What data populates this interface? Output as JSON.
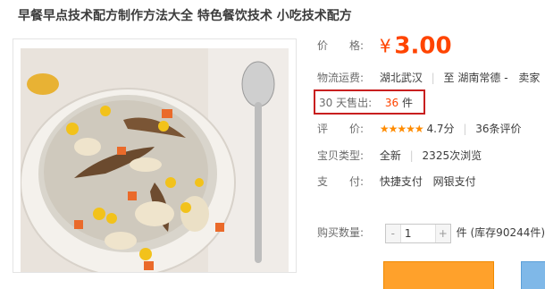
{
  "title": "早餐早点技术配方制作方法大全 特色餐饮技术 小吃技术配方",
  "price": {
    "label": "价　　格:",
    "symbol": "¥",
    "value": "3.00"
  },
  "shipping": {
    "label": "物流运费:",
    "from": "湖北武汉",
    "divider": "至",
    "to": "湖南常德",
    "chevron": "-",
    "seller": "卖家"
  },
  "sales": {
    "label": "30 天售出:",
    "count": "36",
    "unit": "件"
  },
  "rating": {
    "label": "评　　价:",
    "stars": "★★★★★",
    "score": "4.7分",
    "reviews": "36条评价"
  },
  "item_info": {
    "label": "宝贝类型:",
    "condition": "全新",
    "views": "2325次浏览"
  },
  "payment": {
    "label": "支　　付:",
    "methods": [
      "快捷支付",
      "网银支付"
    ]
  },
  "quantity": {
    "label": "购买数量:",
    "minus": "-",
    "value": "1",
    "plus": "+",
    "unit": "件",
    "stock": "(库存90244件)"
  },
  "colors": {
    "price": "#ff4400",
    "sold_box_border": "#c81f1f",
    "buy_button": "#ffa12b",
    "cart_button": "#7fb8e8",
    "star": "#ff8b00"
  }
}
